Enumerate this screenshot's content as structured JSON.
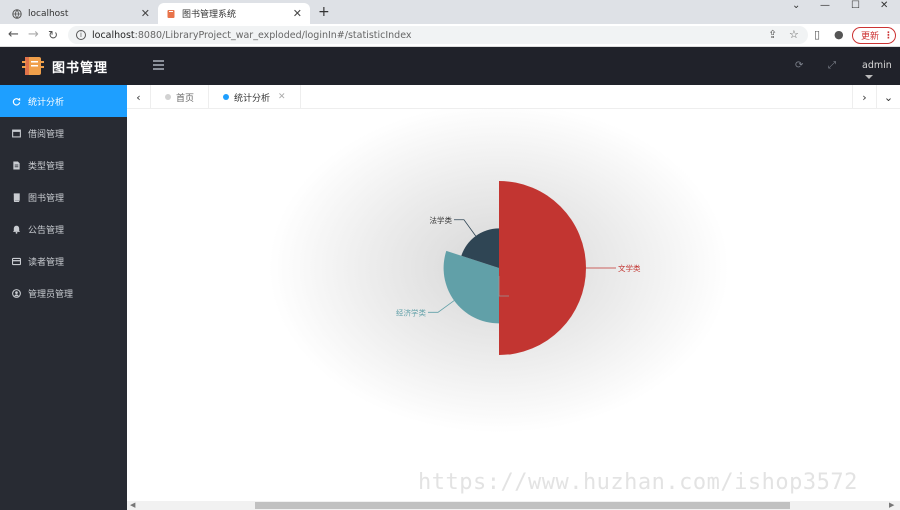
{
  "browser": {
    "tabs": [
      {
        "title": "localhost",
        "active": false
      },
      {
        "title": "图书管理系统",
        "active": true
      }
    ],
    "url_host": "localhost",
    "url_path": ":8080/LibraryProject_war_exploded/loginIn#/statisticIndex",
    "update_label": "更新"
  },
  "app": {
    "logo_text": "图书管理",
    "user": "admin"
  },
  "sidebar": {
    "items": [
      {
        "label": "统计分析",
        "icon": "refresh-icon",
        "active": true
      },
      {
        "label": "借阅管理",
        "icon": "window-icon",
        "active": false
      },
      {
        "label": "类型管理",
        "icon": "file-icon",
        "active": false
      },
      {
        "label": "图书管理",
        "icon": "book-icon",
        "active": false
      },
      {
        "label": "公告管理",
        "icon": "bell-icon",
        "active": false
      },
      {
        "label": "读者管理",
        "icon": "card-icon",
        "active": false
      },
      {
        "label": "管理员管理",
        "icon": "user-circle-icon",
        "active": false
      }
    ]
  },
  "pagetabs": {
    "items": [
      {
        "label": "首页",
        "closable": false,
        "active": false
      },
      {
        "label": "统计分析",
        "closable": true,
        "active": true
      }
    ]
  },
  "chart_data": {
    "type": "pie",
    "style": "nightingale-rose",
    "series": [
      {
        "name": "文学类",
        "value": 50,
        "color": "#c23531"
      },
      {
        "name": "",
        "value": 0,
        "color": "#999999"
      },
      {
        "name": "经济学类",
        "value": 30,
        "color": "#61a0a8"
      },
      {
        "name": "法学类",
        "value": 20,
        "color": "#2f4554"
      }
    ]
  },
  "watermark": "https://www.huzhan.com/ishop3572",
  "colors": {
    "accent": "#1e9fff",
    "sidebar": "#282b33",
    "header": "#20222a"
  }
}
